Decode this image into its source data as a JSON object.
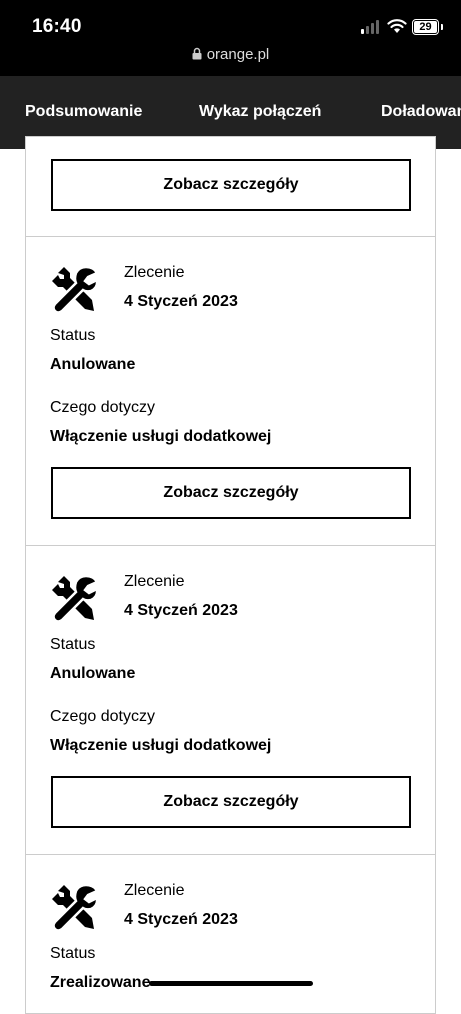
{
  "status_bar": {
    "time": "16:40",
    "battery": "29"
  },
  "browser": {
    "url": "orange.pl"
  },
  "nav": {
    "tabs": [
      "Podsumowanie",
      "Wykaz połączeń",
      "Doładowania"
    ]
  },
  "labels": {
    "order": "Zlecenie",
    "status": "Status",
    "concerns": "Czego dotyczy",
    "details_button": "Zobacz szczegóły"
  },
  "orders": [
    {
      "date": "4 Styczeń 2023",
      "status": "Anulowane",
      "concerns": "Włączenie usługi dodatkowej"
    },
    {
      "date": "4 Styczeń 2023",
      "status": "Anulowane",
      "concerns": "Włączenie usługi dodatkowej"
    },
    {
      "date": "4 Styczeń 2023",
      "status": "Zrealizowane"
    }
  ]
}
